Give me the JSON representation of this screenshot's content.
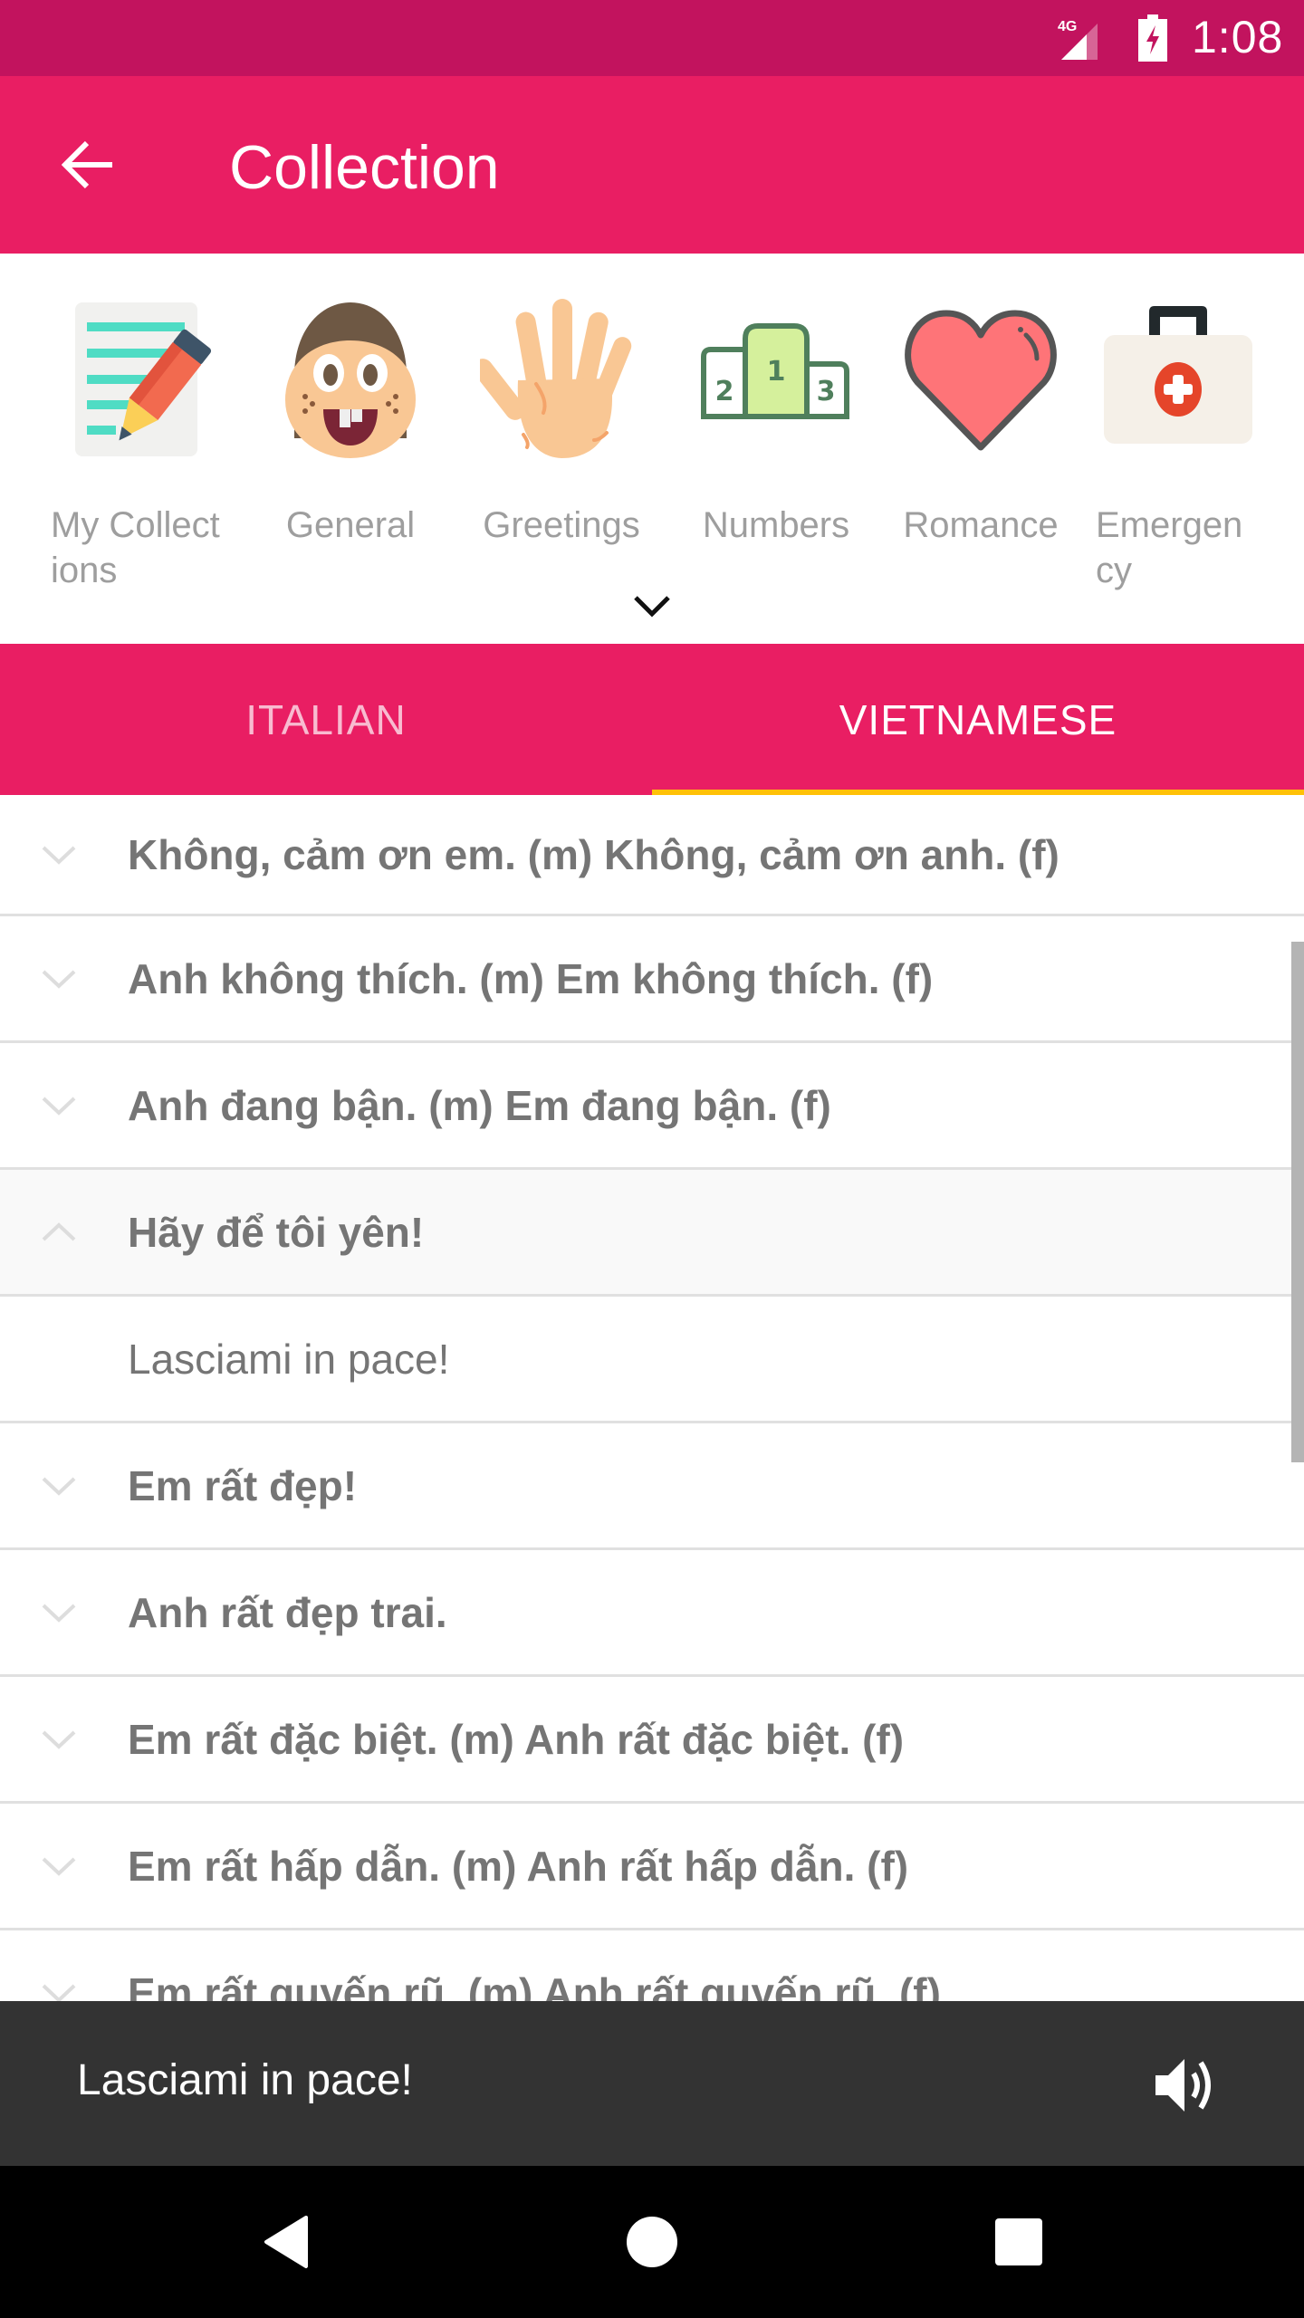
{
  "status_bar": {
    "network": "4G",
    "time": "1:08",
    "icons": [
      "signal-icon",
      "battery-charging-icon"
    ]
  },
  "toolbar": {
    "title": "Collection",
    "back_icon": "arrow-back-icon"
  },
  "categories": [
    {
      "label": "My Collect\nions",
      "label_line1": "My Collect",
      "label_line2": "ions",
      "icon": "notepad-pencil-icon"
    },
    {
      "label": "General",
      "icon": "girl-face-icon"
    },
    {
      "label": "Greetings",
      "icon": "waving-hand-icon"
    },
    {
      "label": "Numbers",
      "icon": "podium-icon"
    },
    {
      "label": "Romance",
      "icon": "heart-icon"
    },
    {
      "label": "Emergen\ncy",
      "label_line1": "Emergen",
      "label_line2": "cy",
      "icon": "first-aid-kit-icon"
    }
  ],
  "expand_icon": "chevron-down-icon",
  "tabs": [
    {
      "label": "ITALIAN",
      "active": false
    },
    {
      "label": "VIETNAMESE",
      "active": true
    }
  ],
  "colors": {
    "status_bar": "#c2135e",
    "primary": "#e91e63",
    "tab_indicator": "#ffc107",
    "inactive_tab_text": "#f8bbd0",
    "snackbar": "#333333"
  },
  "phrases": [
    {
      "text": "Không, cảm ơn em. (m)  Không, cảm ơn anh. (f)",
      "expanded": false
    },
    {
      "text": "Anh không thích. (m)  Em không thích. (f)",
      "expanded": false
    },
    {
      "text": "Anh đang bận. (m)  Em đang bận. (f)",
      "expanded": false
    },
    {
      "text": "Hãy để tôi yên!",
      "expanded": true,
      "translation": "Lasciami in pace!"
    },
    {
      "text": "Em rất đẹp!",
      "expanded": false
    },
    {
      "text": "Anh rất đẹp trai.",
      "expanded": false
    },
    {
      "text": "Em rất đặc biệt. (m)  Anh rất đặc biệt. (f)",
      "expanded": false
    },
    {
      "text": "Em rất hấp dẫn. (m)  Anh rất hấp dẫn. (f)",
      "expanded": false
    },
    {
      "text": "Em rất quyến rũ. (m)  Anh rất quyến rũ. (f)",
      "expanded": false
    }
  ],
  "snackbar": {
    "message": "Lasciami in pace!",
    "action_icon": "speaker-icon"
  },
  "navbar": {
    "buttons": [
      "back-nav-icon",
      "home-nav-icon",
      "recents-nav-icon"
    ]
  }
}
